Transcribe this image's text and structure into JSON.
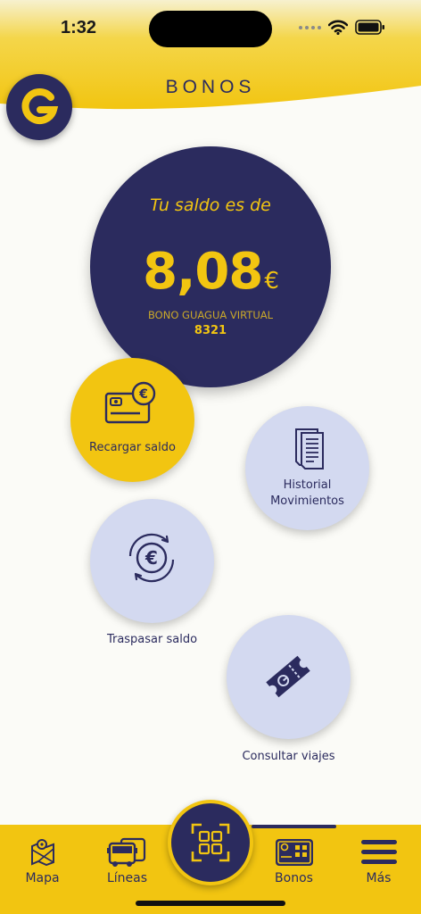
{
  "status_bar": {
    "time": "1:32"
  },
  "header": {
    "title": "BONOS",
    "logo_icon": "g-logo-icon"
  },
  "balance": {
    "label": "Tu saldo es de",
    "amount": "8,08",
    "currency": "€",
    "card_type": "BONO GUAGUA VIRTUAL",
    "card_number": "8321"
  },
  "actions": {
    "recharge": {
      "label": "Recargar saldo",
      "icon": "card-euro-icon"
    },
    "history": {
      "label_line1": "Historial",
      "label_line2": "Movimientos",
      "icon": "documents-icon"
    },
    "transfer": {
      "label": "Traspasar saldo",
      "icon": "euro-refresh-icon"
    },
    "trips": {
      "label": "Consultar viajes",
      "icon": "ticket-icon"
    }
  },
  "tabbar": {
    "items": [
      {
        "label": "Mapa",
        "icon": "map-icon"
      },
      {
        "label": "Líneas",
        "icon": "bus-icon"
      },
      {
        "label": "",
        "icon": "scan-qr-icon"
      },
      {
        "label": "Bonos",
        "icon": "bono-card-icon",
        "active": true
      },
      {
        "label": "Más",
        "icon": "menu-icon"
      }
    ]
  },
  "colors": {
    "navy": "#2b2b5e",
    "yellow": "#f2c511",
    "lilac": "#d3d9f0",
    "background": "#fbfbf7"
  }
}
